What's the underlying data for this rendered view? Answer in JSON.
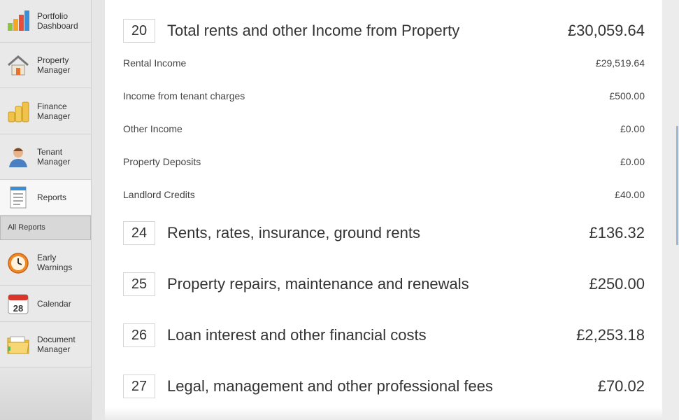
{
  "sidebar": {
    "items": [
      {
        "label_line1": "Portfolio",
        "label_line2": "Dashboard",
        "icon": "bar-chart-icon"
      },
      {
        "label_line1": "Property",
        "label_line2": "Manager",
        "icon": "house-icon"
      },
      {
        "label_line1": "Finance",
        "label_line2": "Manager",
        "icon": "coins-icon"
      },
      {
        "label_line1": "Tenant",
        "label_line2": "Manager",
        "icon": "person-icon"
      },
      {
        "label_line1": "Reports",
        "label_line2": "",
        "icon": "report-icon"
      },
      {
        "label_line1": "Early",
        "label_line2": "Warnings",
        "icon": "alarm-clock-icon"
      },
      {
        "label_line1": "Calendar",
        "label_line2": "",
        "icon": "calendar-icon",
        "calendar_day": "28"
      },
      {
        "label_line1": "Document",
        "label_line2": "Manager",
        "icon": "folder-icon"
      }
    ],
    "sub_item": "All Reports"
  },
  "report": {
    "sections": [
      {
        "number": "20",
        "title": "Total rents and other Income from Property",
        "amount": "£30,059.64"
      },
      {
        "number": "24",
        "title": "Rents, rates, insurance, ground rents",
        "amount": "£136.32"
      },
      {
        "number": "25",
        "title": "Property repairs, maintenance and renewals",
        "amount": "£250.00"
      },
      {
        "number": "26",
        "title": "Loan interest and other financial costs",
        "amount": "£2,253.18"
      },
      {
        "number": "27",
        "title": "Legal, management and other professional fees",
        "amount": "£70.02"
      }
    ],
    "income_rows": [
      {
        "label": "Rental Income",
        "amount": "£29,519.64"
      },
      {
        "label": "Income from tenant charges",
        "amount": "£500.00"
      },
      {
        "label": "Other Income",
        "amount": "£0.00"
      },
      {
        "label": "Property Deposits",
        "amount": "£0.00"
      },
      {
        "label": "Landlord Credits",
        "amount": "£40.00"
      }
    ]
  }
}
